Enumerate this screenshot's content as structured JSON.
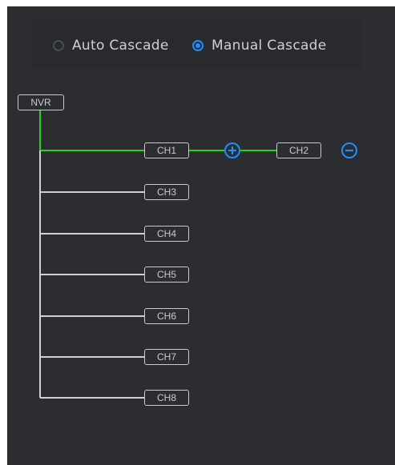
{
  "cascade_mode": {
    "options": [
      {
        "label": "Auto Cascade",
        "checked": false
      },
      {
        "label": "Manual Cascade",
        "checked": true
      }
    ]
  },
  "tree": {
    "root_label": "NVR",
    "active_channel": "CH1",
    "cascaded_channel": "CH2",
    "channels": [
      "CH1",
      "CH3",
      "CH4",
      "CH5",
      "CH6",
      "CH7",
      "CH8"
    ]
  },
  "colors": {
    "active_link": "#22d41c",
    "inactive_link": "#d0d0d0",
    "accent": "#1e8fff"
  }
}
